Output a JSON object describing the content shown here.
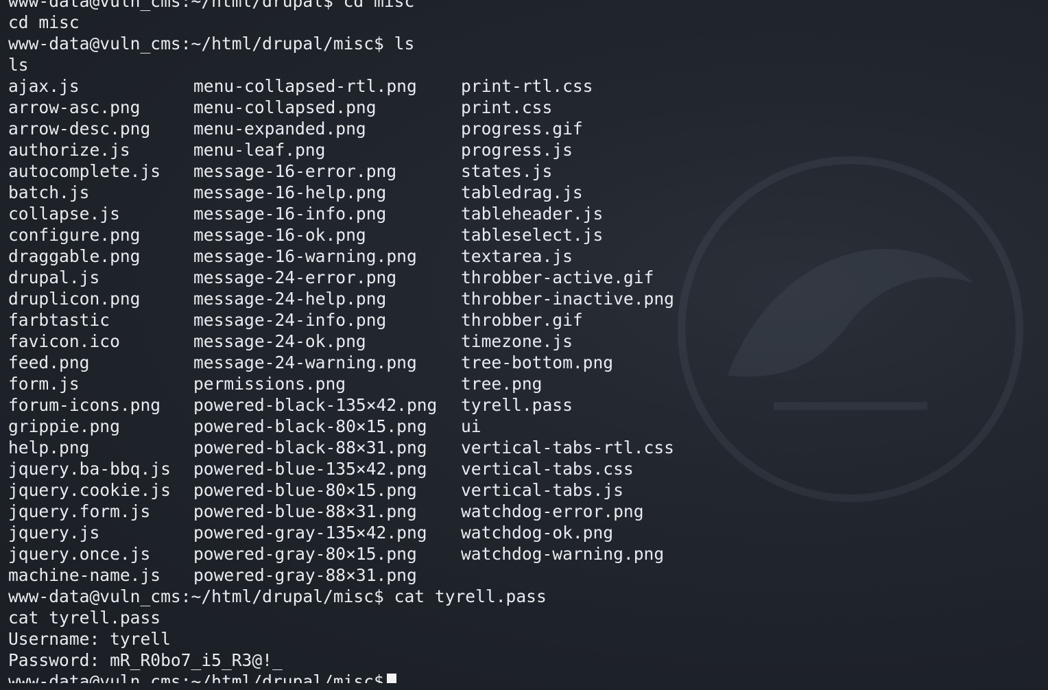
{
  "terminal": {
    "top_partial_line": "www-data@vuln_cms:~/html/drupal$ cd misc",
    "lines_before": [
      "www-data@vuln_cms:~/html/drupal$ cd misc",
      "cd misc",
      "www-data@vuln_cms:~/html/drupal/misc$ ls",
      "ls"
    ],
    "ls_rows": [
      [
        "ajax.js",
        "menu-collapsed-rtl.png",
        "print-rtl.css"
      ],
      [
        "arrow-asc.png",
        "menu-collapsed.png",
        "print.css"
      ],
      [
        "arrow-desc.png",
        "menu-expanded.png",
        "progress.gif"
      ],
      [
        "authorize.js",
        "menu-leaf.png",
        "progress.js"
      ],
      [
        "autocomplete.js",
        "message-16-error.png",
        "states.js"
      ],
      [
        "batch.js",
        "message-16-help.png",
        "tabledrag.js"
      ],
      [
        "collapse.js",
        "message-16-info.png",
        "tableheader.js"
      ],
      [
        "configure.png",
        "message-16-ok.png",
        "tableselect.js"
      ],
      [
        "draggable.png",
        "message-16-warning.png",
        "textarea.js"
      ],
      [
        "drupal.js",
        "message-24-error.png",
        "throbber-active.gif"
      ],
      [
        "druplicon.png",
        "message-24-help.png",
        "throbber-inactive.png"
      ],
      [
        "farbtastic",
        "message-24-info.png",
        "throbber.gif"
      ],
      [
        "favicon.ico",
        "message-24-ok.png",
        "timezone.js"
      ],
      [
        "feed.png",
        "message-24-warning.png",
        "tree-bottom.png"
      ],
      [
        "form.js",
        "permissions.png",
        "tree.png"
      ],
      [
        "forum-icons.png",
        "powered-black-135×42.png",
        "tyrell.pass"
      ],
      [
        "grippie.png",
        "powered-black-80×15.png",
        "ui"
      ],
      [
        "help.png",
        "powered-black-88×31.png",
        "vertical-tabs-rtl.css"
      ],
      [
        "jquery.ba-bbq.js",
        "powered-blue-135×42.png",
        "vertical-tabs.css"
      ],
      [
        "jquery.cookie.js",
        "powered-blue-80×15.png",
        "vertical-tabs.js"
      ],
      [
        "jquery.form.js",
        "powered-blue-88×31.png",
        "watchdog-error.png"
      ],
      [
        "jquery.js",
        "powered-gray-135×42.png",
        "watchdog-ok.png"
      ],
      [
        "jquery.once.js",
        "powered-gray-80×15.png",
        "watchdog-warning.png"
      ],
      [
        "machine-name.js",
        "powered-gray-88×31.png",
        ""
      ]
    ],
    "lines_after": [
      "www-data@vuln_cms:~/html/drupal/misc$ cat tyrell.pass",
      "cat tyrell.pass",
      "Username: tyrell",
      "Password: mR_R0bo7_i5_R3@!_"
    ],
    "bottom_partial_line": "www-data@vuln_cms:~/html/drupal/misc$",
    "colors": {
      "background": "#1f232b",
      "foreground": "#e9ecef",
      "cursor": "#f2f2f2"
    }
  }
}
